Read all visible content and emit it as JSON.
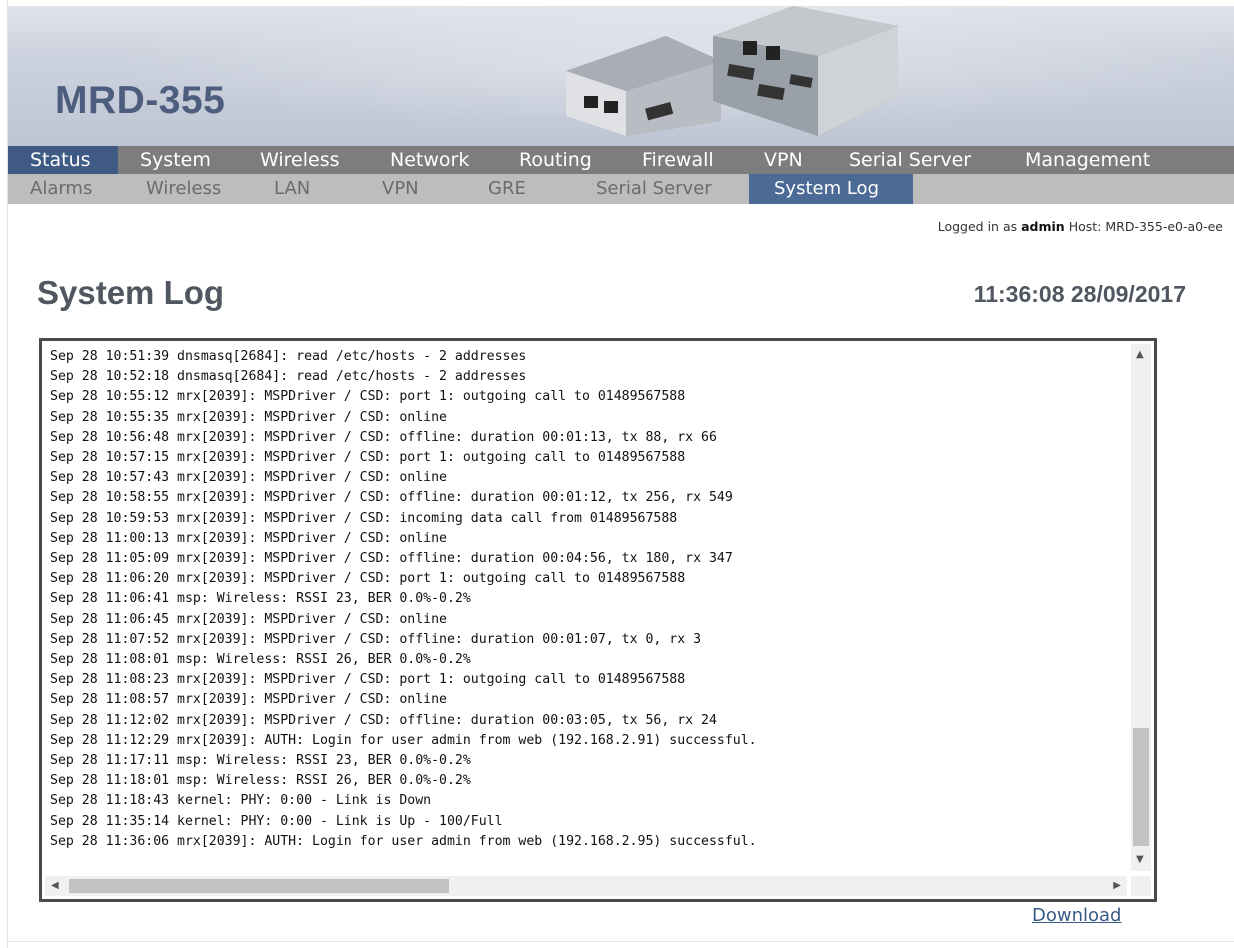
{
  "header": {
    "brand": "MRD-355"
  },
  "main_nav": {
    "items": [
      {
        "label": "Status",
        "active": true
      },
      {
        "label": "System"
      },
      {
        "label": "Wireless"
      },
      {
        "label": "Network"
      },
      {
        "label": "Routing"
      },
      {
        "label": "Firewall"
      },
      {
        "label": "VPN"
      },
      {
        "label": "Serial Server"
      },
      {
        "label": "Management"
      }
    ]
  },
  "sub_nav": {
    "items": [
      {
        "label": "Alarms"
      },
      {
        "label": "Wireless"
      },
      {
        "label": "LAN"
      },
      {
        "label": "VPN"
      },
      {
        "label": "GRE"
      },
      {
        "label": "Serial Server"
      },
      {
        "label": "System Log",
        "active": true
      }
    ]
  },
  "session": {
    "prefix": "Logged in as",
    "user": "admin",
    "host_label": "Host:",
    "host": "MRD-355-e0-a0-ee"
  },
  "page": {
    "title": "System Log",
    "datetime": "11:36:08 28/09/2017"
  },
  "log": {
    "lines": [
      "Sep 28 10:51:39 dnsmasq[2684]: read /etc/hosts - 2 addresses",
      "Sep 28 10:52:18 dnsmasq[2684]: read /etc/hosts - 2 addresses",
      "Sep 28 10:55:12 mrx[2039]: MSPDriver / CSD: port 1: outgoing call to 01489567588",
      "Sep 28 10:55:35 mrx[2039]: MSPDriver / CSD: online",
      "Sep 28 10:56:48 mrx[2039]: MSPDriver / CSD: offline: duration 00:01:13, tx 88, rx 66",
      "Sep 28 10:57:15 mrx[2039]: MSPDriver / CSD: port 1: outgoing call to 01489567588",
      "Sep 28 10:57:43 mrx[2039]: MSPDriver / CSD: online",
      "Sep 28 10:58:55 mrx[2039]: MSPDriver / CSD: offline: duration 00:01:12, tx 256, rx 549",
      "Sep 28 10:59:53 mrx[2039]: MSPDriver / CSD: incoming data call from 01489567588",
      "Sep 28 11:00:13 mrx[2039]: MSPDriver / CSD: online",
      "Sep 28 11:05:09 mrx[2039]: MSPDriver / CSD: offline: duration 00:04:56, tx 180, rx 347",
      "Sep 28 11:06:20 mrx[2039]: MSPDriver / CSD: port 1: outgoing call to 01489567588",
      "Sep 28 11:06:41 msp: Wireless: RSSI 23, BER 0.0%-0.2%",
      "Sep 28 11:06:45 mrx[2039]: MSPDriver / CSD: online",
      "Sep 28 11:07:52 mrx[2039]: MSPDriver / CSD: offline: duration 00:01:07, tx 0, rx 3",
      "Sep 28 11:08:01 msp: Wireless: RSSI 26, BER 0.0%-0.2%",
      "Sep 28 11:08:23 mrx[2039]: MSPDriver / CSD: port 1: outgoing call to 01489567588",
      "Sep 28 11:08:57 mrx[2039]: MSPDriver / CSD: online",
      "Sep 28 11:12:02 mrx[2039]: MSPDriver / CSD: offline: duration 00:03:05, tx 56, rx 24",
      "Sep 28 11:12:29 mrx[2039]: AUTH: Login for user admin from web (192.168.2.91) successful.",
      "Sep 28 11:17:11 msp: Wireless: RSSI 23, BER 0.0%-0.2%",
      "Sep 28 11:18:01 msp: Wireless: RSSI 26, BER 0.0%-0.2%",
      "Sep 28 11:18:43 kernel: PHY: 0:00 - Link is Down",
      "Sep 28 11:35:14 kernel: PHY: 0:00 - Link is Up - 100/Full",
      "Sep 28 11:36:06 mrx[2039]: AUTH: Login for user admin from web (192.168.2.95) successful."
    ]
  },
  "actions": {
    "download": "Download"
  },
  "colors": {
    "nav_bg": "#7d7d7d",
    "nav_active": "#3f5a84",
    "subnav_bg": "#bdbdbd",
    "subnav_active": "#4c6a96",
    "brand": "#4d5d7e"
  }
}
